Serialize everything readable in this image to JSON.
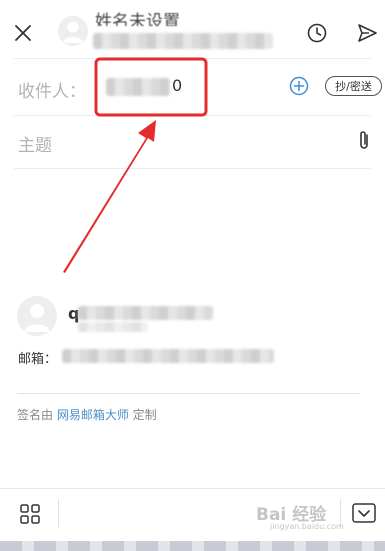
{
  "header": {
    "sender_name": "姓名未设置",
    "close_icon": "close-icon",
    "clock_icon": "clock-icon",
    "send_icon": "send-icon"
  },
  "recipient": {
    "label": "收件人：",
    "value_tail": "0",
    "add_icon": "plus-circle-icon",
    "cc_bcc_label": "抄/密送"
  },
  "subject": {
    "placeholder": "主题",
    "attach_icon": "paperclip-icon"
  },
  "signature": {
    "name_initial": "q",
    "email_label": "邮箱：",
    "footer_prefix": "签名由 ",
    "footer_link": "网易邮箱大师",
    "footer_suffix": " 定制"
  },
  "toolbar": {
    "grid_icon": "grid-icon",
    "collapse_icon": "chevron-down-icon"
  },
  "annotation": {
    "highlight_color": "#e52b2b"
  },
  "watermark": {
    "text": "Bai 经验",
    "sub": "jingyan.baidu.com"
  }
}
